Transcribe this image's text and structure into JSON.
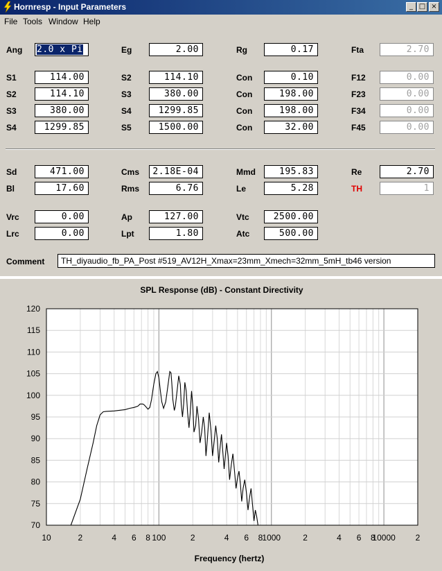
{
  "window": {
    "title": "Hornresp - Input Parameters",
    "min_glyph": "_",
    "max_glyph": "□",
    "close_glyph": "×"
  },
  "menu": [
    "File",
    "Tools",
    "Window",
    "Help"
  ],
  "params": {
    "Ang": "2.0 x Pi",
    "Eg": "2.00",
    "Rg": "0.17",
    "Fta": "2.70",
    "row_S1": {
      "a_label": "S1",
      "a_value": "114.00",
      "b_label": "S2",
      "b_value": "114.10",
      "c_label": "Con",
      "c_value": "0.10",
      "d_label": "F12",
      "d_value": "0.00"
    },
    "row_S2": {
      "a_label": "S2",
      "a_value": "114.10",
      "b_label": "S3",
      "b_value": "380.00",
      "c_label": "Con",
      "c_value": "198.00",
      "d_label": "F23",
      "d_value": "0.00"
    },
    "row_S3": {
      "a_label": "S3",
      "a_value": "380.00",
      "b_label": "S4",
      "b_value": "1299.85",
      "c_label": "Con",
      "c_value": "198.00",
      "d_label": "F34",
      "d_value": "0.00"
    },
    "row_S4": {
      "a_label": "S4",
      "a_value": "1299.85",
      "b_label": "S5",
      "b_value": "1500.00",
      "c_label": "Con",
      "c_value": "32.00",
      "d_label": "F45",
      "d_value": "0.00"
    },
    "Sd": "471.00",
    "Cms": "2.18E-04",
    "Mmd": "195.83",
    "Re": "2.70",
    "Bl": "17.60",
    "Rms": "6.76",
    "Le": "5.28",
    "TH": "1",
    "Vrc": "0.00",
    "Ap": "127.00",
    "Vtc": "2500.00",
    "Lrc": "0.00",
    "Lpt": "1.80",
    "Atc": "500.00"
  },
  "labels": {
    "Ang": "Ang",
    "Eg": "Eg",
    "Rg": "Rg",
    "Fta": "Fta",
    "Sd": "Sd",
    "Cms": "Cms",
    "Mmd": "Mmd",
    "Re": "Re",
    "Bl": "Bl",
    "Rms": "Rms",
    "Le": "Le",
    "TH": "TH",
    "Vrc": "Vrc",
    "Ap": "Ap",
    "Vtc": "Vtc",
    "Lrc": "Lrc",
    "Lpt": "Lpt",
    "Atc": "Atc",
    "Comment": "Comment"
  },
  "comment": "TH_diyaudio_fb_PA_Post #519_AV12H_Xmax=23mm_Xmech=32mm_5mH_tb46 version",
  "colors": {
    "selection": "#0a246a",
    "th_label": "#e00000",
    "title_bar": "#0a246a"
  },
  "chart_data": {
    "type": "line",
    "title": "SPL Response (dB) - Constant Directivity",
    "xlabel": "Frequency (hertz)",
    "ylabel": "",
    "x_scale": "log",
    "xlim": [
      10,
      20000
    ],
    "ylim": [
      70,
      120
    ],
    "grid": true,
    "xticks": [
      {
        "v": 10,
        "label": "10"
      },
      {
        "v": 20,
        "label": "2"
      },
      {
        "v": 40,
        "label": "4"
      },
      {
        "v": 60,
        "label": "6"
      },
      {
        "v": 80,
        "label": "8"
      },
      {
        "v": 100,
        "label": "100"
      },
      {
        "v": 200,
        "label": "2"
      },
      {
        "v": 400,
        "label": "4"
      },
      {
        "v": 600,
        "label": "6"
      },
      {
        "v": 800,
        "label": "8"
      },
      {
        "v": 1000,
        "label": "1000"
      },
      {
        "v": 2000,
        "label": "2"
      },
      {
        "v": 4000,
        "label": "4"
      },
      {
        "v": 6000,
        "label": "6"
      },
      {
        "v": 8000,
        "label": "8"
      },
      {
        "v": 10000,
        "label": "10000"
      },
      {
        "v": 20000,
        "label": "2"
      }
    ],
    "yticks": [
      70,
      75,
      80,
      85,
      90,
      95,
      100,
      105,
      110,
      115,
      120
    ],
    "series": [
      {
        "x": [
          16.5,
          20,
          23,
          26,
          28,
          30,
          32,
          34,
          40,
          50,
          55,
          60,
          65,
          68,
          72,
          74,
          77,
          80,
          83,
          86,
          90,
          94,
          97,
          100,
          103,
          106,
          110,
          115,
          120,
          125,
          128,
          130,
          133,
          137,
          140,
          145,
          150,
          155,
          158,
          162,
          166,
          170,
          175,
          180,
          185,
          190,
          195,
          200,
          205,
          212,
          218,
          225,
          232,
          240,
          248,
          255,
          262,
          270,
          280,
          290,
          300,
          310,
          320,
          330,
          340,
          350,
          360,
          370,
          380,
          390,
          400,
          412,
          425,
          440,
          455,
          470,
          485,
          500,
          515,
          530,
          545,
          560,
          580,
          600,
          620,
          640,
          660,
          680,
          700,
          720,
          740,
          760,
          770
        ],
        "y": [
          70,
          76,
          83,
          89,
          93,
          95.5,
          96.2,
          96.3,
          96.4,
          96.7,
          97,
          97.2,
          97.5,
          98,
          98,
          97.8,
          97.3,
          96.8,
          97.2,
          99,
          102.5,
          105,
          105.5,
          104,
          101,
          98.5,
          97,
          98.5,
          102,
          105.5,
          105.2,
          103,
          99,
          96.5,
          97.5,
          101,
          104.5,
          102.5,
          98,
          95,
          98,
          103,
          101,
          96,
          92.5,
          96,
          101,
          97.5,
          91.5,
          93,
          97.5,
          94.5,
          89,
          91.5,
          95,
          92.5,
          86,
          90,
          96,
          92,
          86,
          89.5,
          93,
          90,
          84.5,
          88,
          91,
          87,
          83,
          86,
          89,
          86,
          80.5,
          84,
          86.5,
          82.5,
          78.5,
          81,
          82.5,
          79.5,
          75.5,
          78.5,
          80.5,
          77.5,
          73.5,
          76.5,
          78.5,
          74.5,
          71,
          73.5,
          72,
          70,
          70
        ]
      }
    ]
  }
}
